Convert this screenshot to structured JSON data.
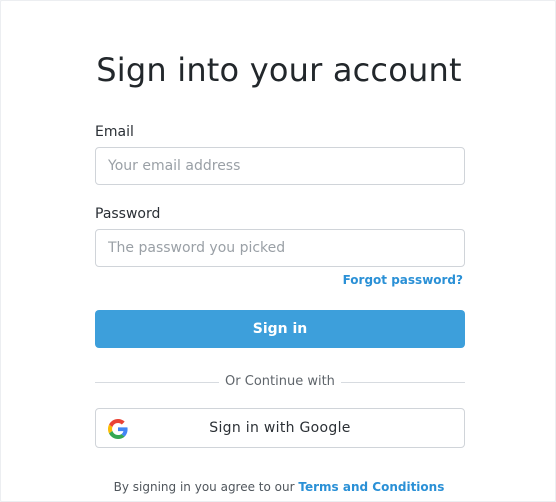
{
  "title": "Sign into your account",
  "email": {
    "label": "Email",
    "placeholder": "Your email address",
    "value": ""
  },
  "password": {
    "label": "Password",
    "placeholder": "The password you picked",
    "value": ""
  },
  "forgot_password": "Forgot password?",
  "sign_in_button": "Sign in",
  "divider_text": "Or Continue with",
  "google_button": "Sign in with Google",
  "terms": {
    "prefix": "By signing in you agree to our",
    "link": "Terms and Conditions"
  },
  "colors": {
    "primary": "#3d9fdb",
    "link": "#2a90d6",
    "background": "#ffffff"
  },
  "icons": {
    "google": "google-logo-icon"
  }
}
